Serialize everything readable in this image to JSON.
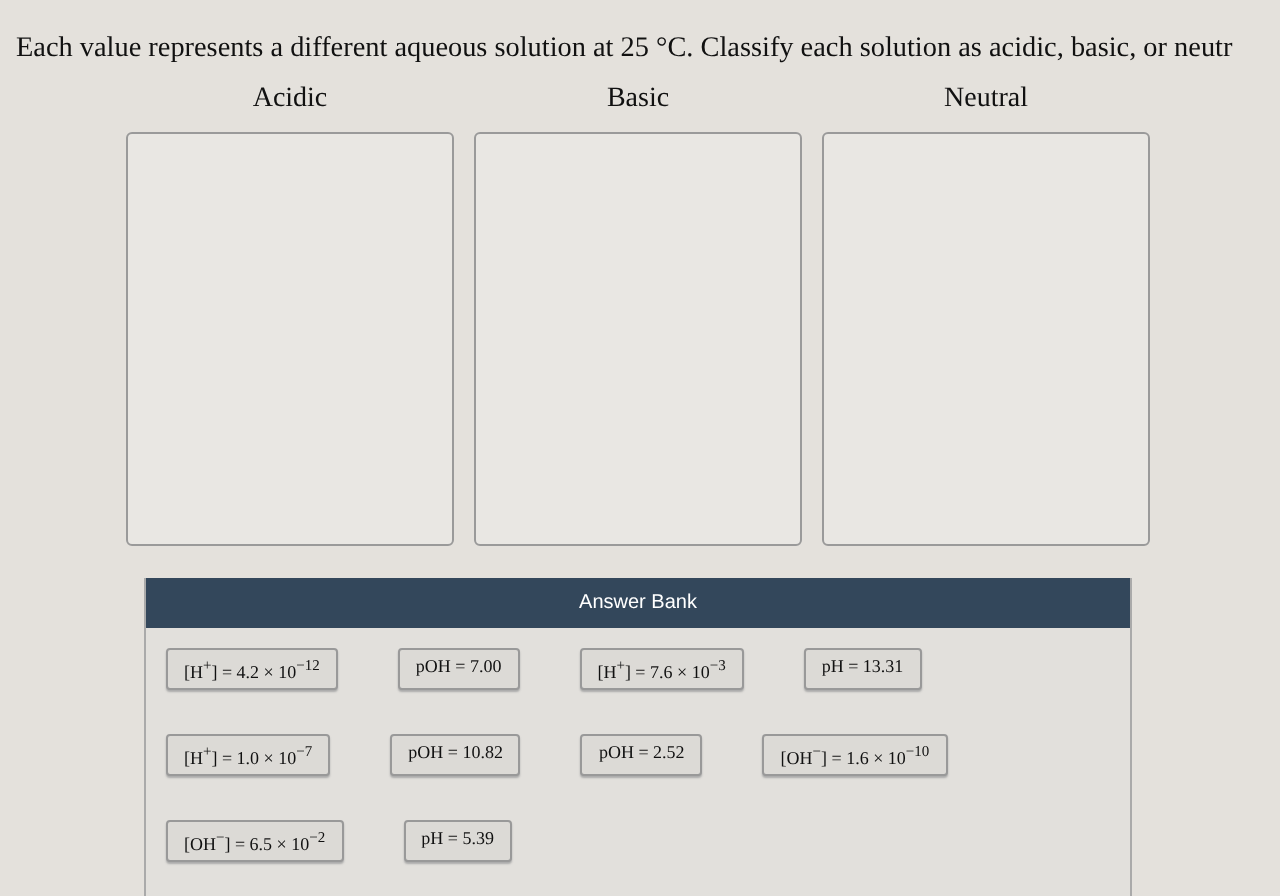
{
  "instruction": "Each value represents a different aqueous solution at 25 °C. Classify each solution as acidic, basic, or neutr",
  "bins": [
    {
      "label": "Acidic"
    },
    {
      "label": "Basic"
    },
    {
      "label": "Neutral"
    }
  ],
  "answer_bank": {
    "title": "Answer Bank",
    "rows": [
      [
        "[H$^{+}$] = 4.2 × 10$^{−12}$",
        "pOH = 7.00",
        "[H$^{+}$] = 7.6 × 10$^{−3}$",
        "pH = 13.31"
      ],
      [
        "[H$^{+}$] = 1.0 × 10$^{−7}$",
        "pOH = 10.82",
        "pOH = 2.52",
        "[OH$^{−}$] = 1.6 × 10$^{−10}$"
      ],
      [
        "[OH$^{−}$] = 6.5 × 10$^{−2}$",
        "pH = 5.39"
      ]
    ]
  }
}
